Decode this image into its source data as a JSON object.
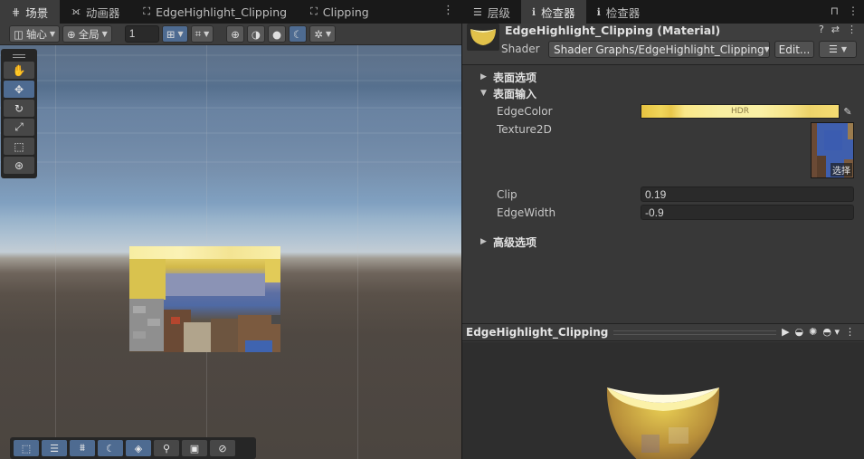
{
  "scene_tabs": [
    {
      "glyph": "⋕",
      "label": "场景",
      "active": true
    },
    {
      "glyph": "⟗",
      "label": "动画器",
      "active": false
    },
    {
      "glyph": "⛶",
      "label": "EdgeHighlight_Clipping",
      "active": false
    },
    {
      "glyph": "⛶",
      "label": "Clipping",
      "active": false
    }
  ],
  "scene_toolbar": {
    "pivot_label": "轴心",
    "global_label": "全局",
    "grid_snap_value": "1"
  },
  "right_tabs": [
    {
      "glyph": "☰",
      "label": "层级",
      "active": false
    },
    {
      "glyph": "ℹ",
      "label": "检查器",
      "active": true
    },
    {
      "glyph": "ℹ",
      "label": "检查器",
      "active": false
    }
  ],
  "material": {
    "title": "EdgeHighlight_Clipping (Material)",
    "shader_label": "Shader",
    "shader_value": "Shader Graphs/EdgeHighlight_Clipping",
    "edit_label": "Edit..."
  },
  "sections": {
    "surface_options": "表面选项",
    "surface_inputs": "表面输入",
    "advanced_options": "高级选项"
  },
  "properties": {
    "edge_color_label": "EdgeColor",
    "edge_color_hdr": "HDR",
    "texture_label": "Texture2D",
    "texture_select": "选择",
    "clip_label": "Clip",
    "clip_value": "0.19",
    "edge_width_label": "EdgeWidth",
    "edge_width_value": "-0.9"
  },
  "preview": {
    "title": "EdgeHighlight_Clipping"
  },
  "colors": {
    "accent": "#4e6b91",
    "edge_color": "#f8eea0"
  }
}
